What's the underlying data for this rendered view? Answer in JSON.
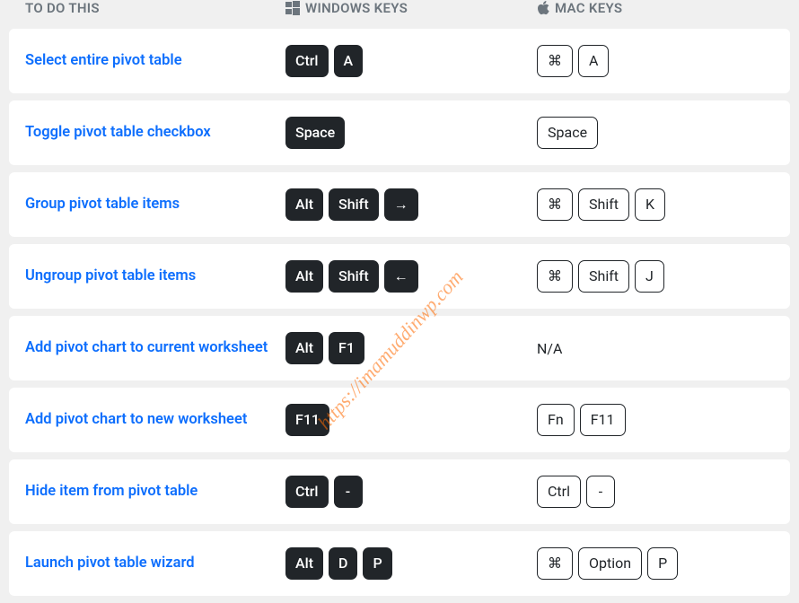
{
  "headers": {
    "action": "To Do This",
    "windows": "Windows Keys",
    "mac": "Mac Keys"
  },
  "watermark": "https://imamuddinwp.com",
  "keysymbols": {
    "cmd": "⌘",
    "arrow_right": "→",
    "arrow_left": "←"
  },
  "rows": [
    {
      "action": "Select entire pivot table",
      "win": [
        "Ctrl",
        "A"
      ],
      "mac": [
        "⌘",
        "A"
      ]
    },
    {
      "action": "Toggle pivot table checkbox",
      "win": [
        "Space"
      ],
      "mac": [
        "Space"
      ]
    },
    {
      "action": "Group pivot table items",
      "win": [
        "Alt",
        "Shift",
        "→"
      ],
      "mac": [
        "⌘",
        "Shift",
        "K"
      ]
    },
    {
      "action": "Ungroup pivot table items",
      "win": [
        "Alt",
        "Shift",
        "←"
      ],
      "mac": [
        "⌘",
        "Shift",
        "J"
      ]
    },
    {
      "action": "Add pivot chart to current worksheet",
      "win": [
        "Alt",
        "F1"
      ],
      "mac_na": "N/A"
    },
    {
      "action": "Add pivot chart to new worksheet",
      "win": [
        "F11"
      ],
      "mac": [
        "Fn",
        "F11"
      ]
    },
    {
      "action": "Hide item from pivot table",
      "win": [
        "Ctrl",
        "-"
      ],
      "mac": [
        "Ctrl",
        "-"
      ]
    },
    {
      "action": "Launch pivot table wizard",
      "win": [
        "Alt",
        "D",
        "P"
      ],
      "mac": [
        "⌘",
        "Option",
        "P"
      ]
    }
  ]
}
